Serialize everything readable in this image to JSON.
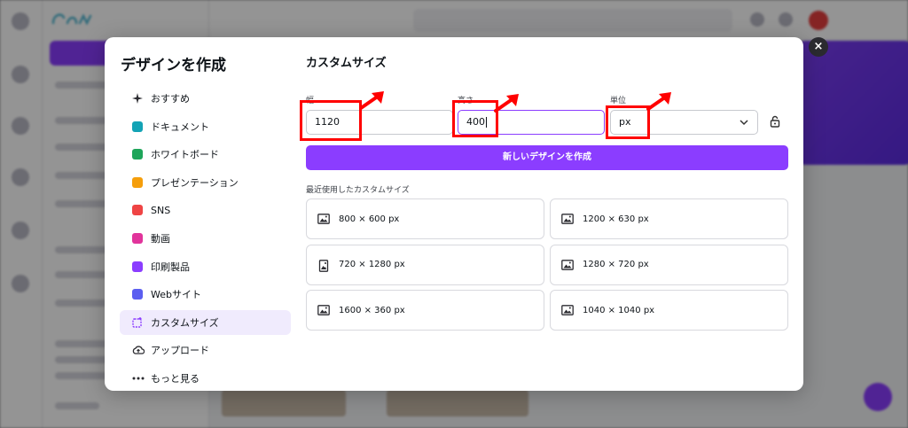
{
  "modal": {
    "title": "デザインを作成",
    "close_glyph": "×"
  },
  "nav": [
    {
      "label": "おすすめ",
      "icon": "sparkle-icon",
      "color": "#2b2b30",
      "active": false
    },
    {
      "label": "ドキュメント",
      "icon": "document-icon",
      "color": "#13a3b5",
      "active": false
    },
    {
      "label": "ホワイトボード",
      "icon": "whiteboard-icon",
      "color": "#1ea55a",
      "active": false
    },
    {
      "label": "プレゼンテーション",
      "icon": "presentation-icon",
      "color": "#f59e0b",
      "active": false
    },
    {
      "label": "SNS",
      "icon": "heart-icon",
      "color": "#ef4444",
      "active": false
    },
    {
      "label": "動画",
      "icon": "video-icon",
      "color": "#e1349b",
      "active": false
    },
    {
      "label": "印刷製品",
      "icon": "print-icon",
      "color": "#8b3dff",
      "active": false
    },
    {
      "label": "Webサイト",
      "icon": "website-icon",
      "color": "#5b5ef0",
      "active": false
    },
    {
      "label": "カスタムサイズ",
      "icon": "custom-size-icon",
      "color": "#8b3dff",
      "active": true
    },
    {
      "label": "アップロード",
      "icon": "cloud-upload-icon",
      "color": "#2b2b30",
      "active": false
    },
    {
      "label": "もっと見る",
      "icon": "more-dots-icon",
      "color": "#2b2b30",
      "active": false
    }
  ],
  "custom": {
    "title": "カスタムサイズ",
    "width_label": "幅",
    "width_value": "1120",
    "height_label": "高さ",
    "height_value": "400",
    "unit_label": "単位",
    "unit_value": "px",
    "create_button": "新しいデザインを作成",
    "recent_label": "最近使用したカスタムサイズ"
  },
  "recent": [
    {
      "label": "800 × 600 px",
      "icon": "image-icon"
    },
    {
      "label": "1200 × 630 px",
      "icon": "image-icon"
    },
    {
      "label": "720 × 1280 px",
      "icon": "image-portrait-icon"
    },
    {
      "label": "1280 × 720 px",
      "icon": "image-icon"
    },
    {
      "label": "1600 × 360 px",
      "icon": "image-icon"
    },
    {
      "label": "1040 × 1040 px",
      "icon": "image-icon"
    }
  ],
  "colors": {
    "accent": "#8b3dff",
    "annotation": "#ff0000"
  }
}
